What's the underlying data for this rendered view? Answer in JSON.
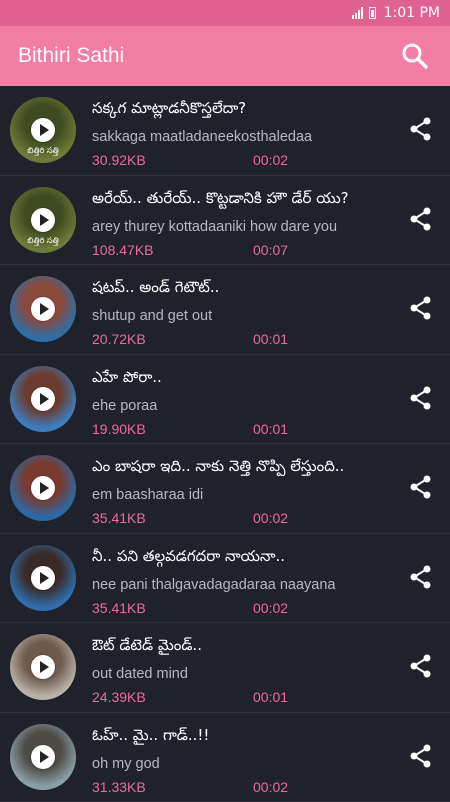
{
  "status_bar": {
    "time": "1:01 PM"
  },
  "app_bar": {
    "title": "Bithiri Sathi",
    "search_icon": "search-icon"
  },
  "colors": {
    "accent": "#f37ea4",
    "status": "#e0628f",
    "background": "#1f222b",
    "meta": "#f06b97"
  },
  "items": [
    {
      "title": "సక్కగ మాట్లాడనీకొస్తలేదా?",
      "subtitle": "sakkaga maatladaneekosthaledaa",
      "size": "30.92KB",
      "duration": "00:02",
      "avatar_caption": "బిత్తిరి సత్తి"
    },
    {
      "title": "అరేయ్.. తురేయ్.. కొట్టడానికి హౌ డేర్ యు?",
      "subtitle": "arey thurey kottadaaniki how dare you",
      "size": "108.47KB",
      "duration": "00:07",
      "avatar_caption": "బిత్తిరి సత్తి"
    },
    {
      "title": "షటప్.. అండ్ గెటౌట్..",
      "subtitle": "shutup and get out",
      "size": "20.72KB",
      "duration": "00:01",
      "avatar_caption": ""
    },
    {
      "title": "ఎహే పోరా..",
      "subtitle": "ehe poraa",
      "size": "19.90KB",
      "duration": "00:01",
      "avatar_caption": ""
    },
    {
      "title": "ఎం బాషరా ఇది.. నాకు నెత్తి నొప్పి లేస్తుంది..",
      "subtitle": "em baasharaa idi",
      "size": "35.41KB",
      "duration": "00:02",
      "avatar_caption": ""
    },
    {
      "title": "నీ.. పని తల్గవడగదరా నాయనా..",
      "subtitle": "nee pani thalgavadagadaraa naayana",
      "size": "35.41KB",
      "duration": "00:02",
      "avatar_caption": ""
    },
    {
      "title": "ఔట్ డేటెడ్ మైండ్..",
      "subtitle": "out dated mind",
      "size": "24.39KB",
      "duration": "00:01",
      "avatar_caption": ""
    },
    {
      "title": "ఓహ్.. మై.. గాడ్..!!",
      "subtitle": "oh my god",
      "size": "31.33KB",
      "duration": "00:02",
      "avatar_caption": ""
    }
  ]
}
